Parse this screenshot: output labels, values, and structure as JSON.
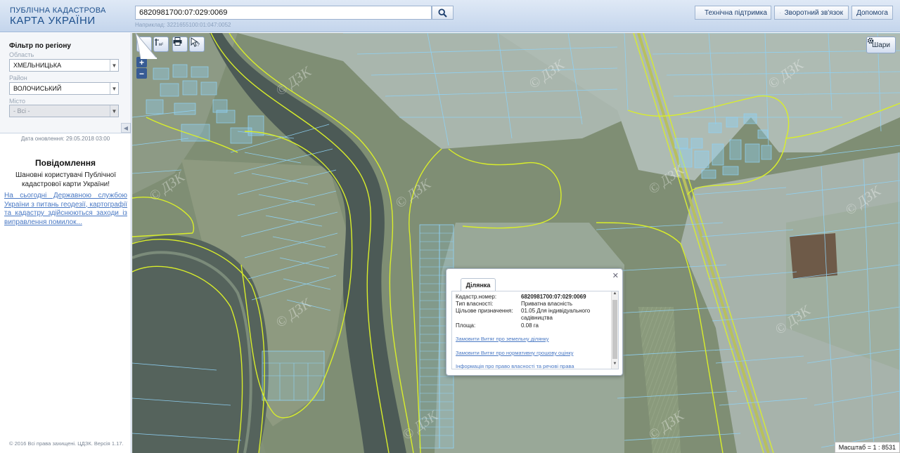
{
  "header": {
    "logo_line1": "ПУБЛІЧНА КАДАСТРОВА",
    "logo_line2": "КАРТА УКРАЇНИ",
    "search_value": "6820981700:07:029:0069",
    "search_example": "Наприклад: 3221655100:01:047:0052",
    "support_label": "Технічна підтримка",
    "feedback_label": "Зворотний зв'язок",
    "help_label": "Допомога"
  },
  "sidebar": {
    "filter_title": "Фільтр по регіону",
    "region_label": "Область",
    "region_value": "ХМЕЛЬНИЦЬКА",
    "district_label": "Район",
    "district_value": "ВОЛОЧИСЬКИЙ",
    "city_label": "Місто",
    "city_value": "- Всі -",
    "update_date": "Дата оновлення: 29.05.2018 03:00",
    "news_title": "Повідомлення",
    "news_body": "Шановні користувачі Публічної кадастрової карти України!",
    "news_link": "На сьогодні Державною службою України з питань геодезії, картографії та кадастру здійснюються заходи із виправлення помилок...",
    "copyright": "© 2016 Всі права захищені. ЦДЗК. Версія 1.17."
  },
  "map": {
    "layers_label": "Шари",
    "scale_text": "Масштаб = 1 : 8531",
    "watermark": "© ДЗК",
    "zoom_in": "+",
    "zoom_out": "−"
  },
  "popup": {
    "tab_label": "Ділянка",
    "rows": [
      {
        "key": "Кадастр.номер:",
        "value": "6820981700:07:029:0069"
      },
      {
        "key": "Тип власності:",
        "value": "Приватна власність"
      },
      {
        "key": "Цільове призначення:",
        "value": "01.05 Для індивідуального садівництва"
      },
      {
        "key": "Площа:",
        "value": "0.08 га"
      }
    ],
    "links": [
      "Замовити Витяг про земельну ділянку",
      "Замовити Витяг про нормативну грошову оцінку",
      "Інформація про право власності та речові права"
    ]
  },
  "colors": {
    "parcel_outline": "#8fd2f5",
    "boundary_line": "#d9ee2a",
    "river": "#4c5a56",
    "header_text": "#1d4f8c"
  }
}
